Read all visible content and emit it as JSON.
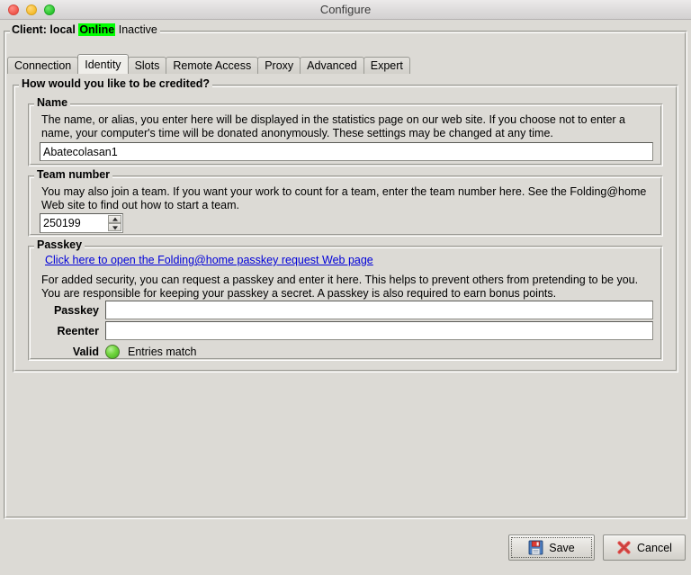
{
  "window": {
    "title": "Configure",
    "traffic_lights": [
      {
        "name": "close-button",
        "color": "#f0564c"
      },
      {
        "name": "minimize-button",
        "color": "#f5bc2e"
      },
      {
        "name": "maximize-button",
        "color": "#29c52e"
      }
    ]
  },
  "client": {
    "prefix": "Client: local",
    "status_badge": "Online",
    "status_badge_color": "#00ff00",
    "activity": "Inactive"
  },
  "tabs": [
    {
      "label": "Connection",
      "active": false
    },
    {
      "label": "Identity",
      "active": true
    },
    {
      "label": "Slots",
      "active": false
    },
    {
      "label": "Remote Access",
      "active": false
    },
    {
      "label": "Proxy",
      "active": false
    },
    {
      "label": "Advanced",
      "active": false
    },
    {
      "label": "Expert",
      "active": false
    }
  ],
  "outer_panel": {
    "legend": "How would you like to be credited?"
  },
  "name_section": {
    "legend": "Name",
    "description": "The name, or alias, you enter here will be displayed in the statistics page on our web site.  If you choose not to enter a name, your computer's time will be donated anonymously.  These settings may be changed at any time.",
    "value": "Abatecolasan1",
    "placeholder": ""
  },
  "team_section": {
    "legend": "Team number",
    "description": "You may also join a team.  If you want your work to count for a team, enter the team number here.  See the Folding@home Web site to find out how to start a team.",
    "value": "250199",
    "spin_up_icon": "triangle-up-icon",
    "spin_down_icon": "triangle-down-icon"
  },
  "passkey_section": {
    "legend": "Passkey",
    "link_text": "Click here to open the Folding@home passkey request Web page",
    "link_color": "#0000d8",
    "description": "For added security, you can request a passkey and enter it here.  This helps to prevent others from pretending to be you.  You are responsible for keeping your passkey a secret.  A passkey is also required to earn bonus points.",
    "passkey_label": "Passkey",
    "passkey_value": "",
    "reenter_label": "Reenter",
    "reenter_value": "",
    "valid_label": "Valid",
    "valid_status": "Entries match",
    "valid_led_color": "#74d640"
  },
  "footer": {
    "save_label": "Save",
    "save_icon": "floppy-disk-icon",
    "cancel_label": "Cancel",
    "cancel_icon": "red-x-icon"
  }
}
